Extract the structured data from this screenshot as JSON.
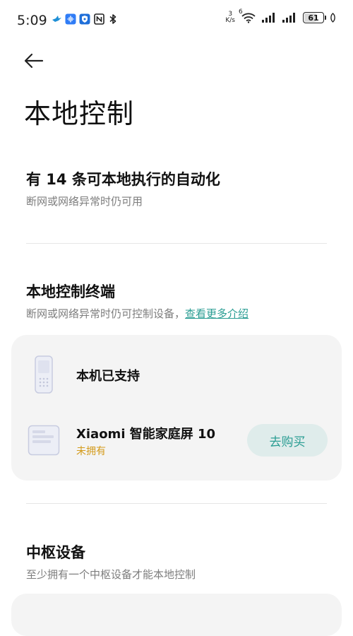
{
  "status_bar": {
    "time": "5:09",
    "net_speed_value": "3",
    "net_speed_unit": "K/s",
    "wifi_badge": "6",
    "battery": "61",
    "battery_level": 0.61,
    "icons": [
      "bird-icon",
      "voice-icon",
      "shield-icon",
      "nfc-icon",
      "bluetooth-icon",
      "wifi-icon",
      "signal-icon",
      "signal-icon",
      "battery-icon",
      "leaf-icon"
    ]
  },
  "header": {
    "back_icon": "back-arrow-icon",
    "title": "本地控制"
  },
  "automation": {
    "title": "有 14 条可本地执行的自动化",
    "subtitle": "断网或网络异常时仍可用"
  },
  "local_terminal": {
    "title": "本地控制终端",
    "subtitle": "断网或网络异常时仍可控制设备，",
    "link": "查看更多介绍",
    "devices": [
      {
        "name": "本机已支持",
        "icon": "phone-icon"
      },
      {
        "name": "Xiaomi 智能家庭屏 10",
        "status": "未拥有",
        "icon": "smart-display-icon",
        "button": "去购买"
      }
    ]
  },
  "hub": {
    "title": "中枢设备",
    "subtitle": "至少拥有一个中枢设备才能本地控制"
  },
  "colors": {
    "accent": "#2a9d93",
    "warning": "#d39a1a",
    "card_bg": "#f4f4f4",
    "button_bg": "#dfeceb"
  }
}
